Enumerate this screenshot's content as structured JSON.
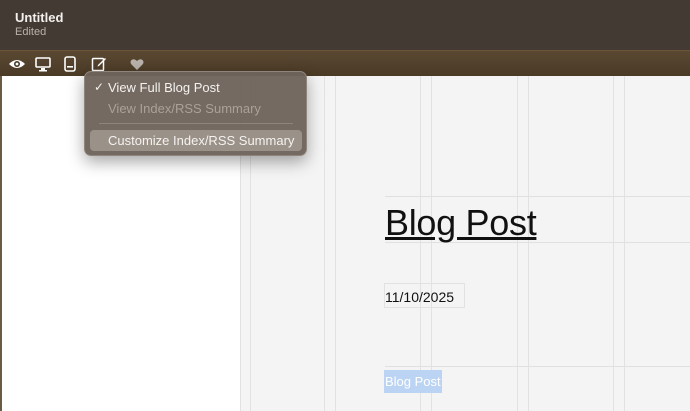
{
  "window": {
    "title": "Untitled",
    "status": "Edited"
  },
  "toolbar": {
    "buttons": [
      {
        "icon": "eye-icon"
      },
      {
        "icon": "desktop-icon"
      },
      {
        "icon": "mobile-icon"
      },
      {
        "icon": "edit-icon"
      },
      {
        "icon": "heart-icon"
      }
    ]
  },
  "menu": {
    "items": [
      {
        "label": "View Full Blog Post",
        "checked": true,
        "enabled": true
      },
      {
        "label": "View Index/RSS Summary",
        "checked": false,
        "enabled": false
      },
      {
        "label": "Customize Index/RSS Summary",
        "checked": false,
        "enabled": true,
        "highlighted": true
      }
    ],
    "check_glyph": "✓"
  },
  "canvas": {
    "post_title": "Blog Post",
    "date": "11/10/2025",
    "post_link": "Blog Post"
  },
  "colors": {
    "titlebar": "#433a34",
    "toolbar": "#4a3a26",
    "canvas_bg": "#f4f4f4",
    "selection": "#bcd4f4"
  }
}
